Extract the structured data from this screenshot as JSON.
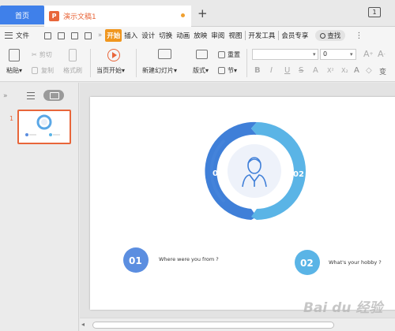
{
  "tabs": {
    "home": "首页",
    "doc_icon": "P",
    "doc_title": "演示文稿1",
    "new_tab": "+",
    "window_icon": "1"
  },
  "menu": {
    "file": "文件",
    "more": "»",
    "tabs": [
      "开始",
      "插入",
      "设计",
      "切换",
      "动画",
      "放映",
      "审阅",
      "视图",
      "开发工具",
      "会员专享"
    ],
    "search": "查找",
    "more_dots": "⋮"
  },
  "ribbon": {
    "paste": "粘贴",
    "cut": "剪切",
    "copy": "复制",
    "format_painter": "格式刷",
    "play_from_current": "当页开始",
    "new_slide": "新建幻灯片",
    "layout": "版式",
    "section": "节",
    "reset": "重置",
    "font_size": "0",
    "format_buttons": [
      "B",
      "I",
      "U",
      "S",
      "A",
      "X²",
      "X₂",
      "A",
      "◇",
      "变"
    ]
  },
  "slide": {
    "left_label": "01",
    "right_label": "02",
    "item1": {
      "number": "01",
      "text": "Where were you from ?"
    },
    "item2": {
      "number": "02",
      "text": "What's your hobby ?"
    }
  },
  "thumbnail": {
    "number": "1"
  },
  "colors": {
    "accent_blue": "#3f80ea",
    "accent_orange": "#e8663a",
    "ring_dark": "#3f7fd8",
    "ring_light": "#5ab4e6",
    "circle_fill": "#5b8ee0"
  },
  "watermark": "Bai du 经验"
}
